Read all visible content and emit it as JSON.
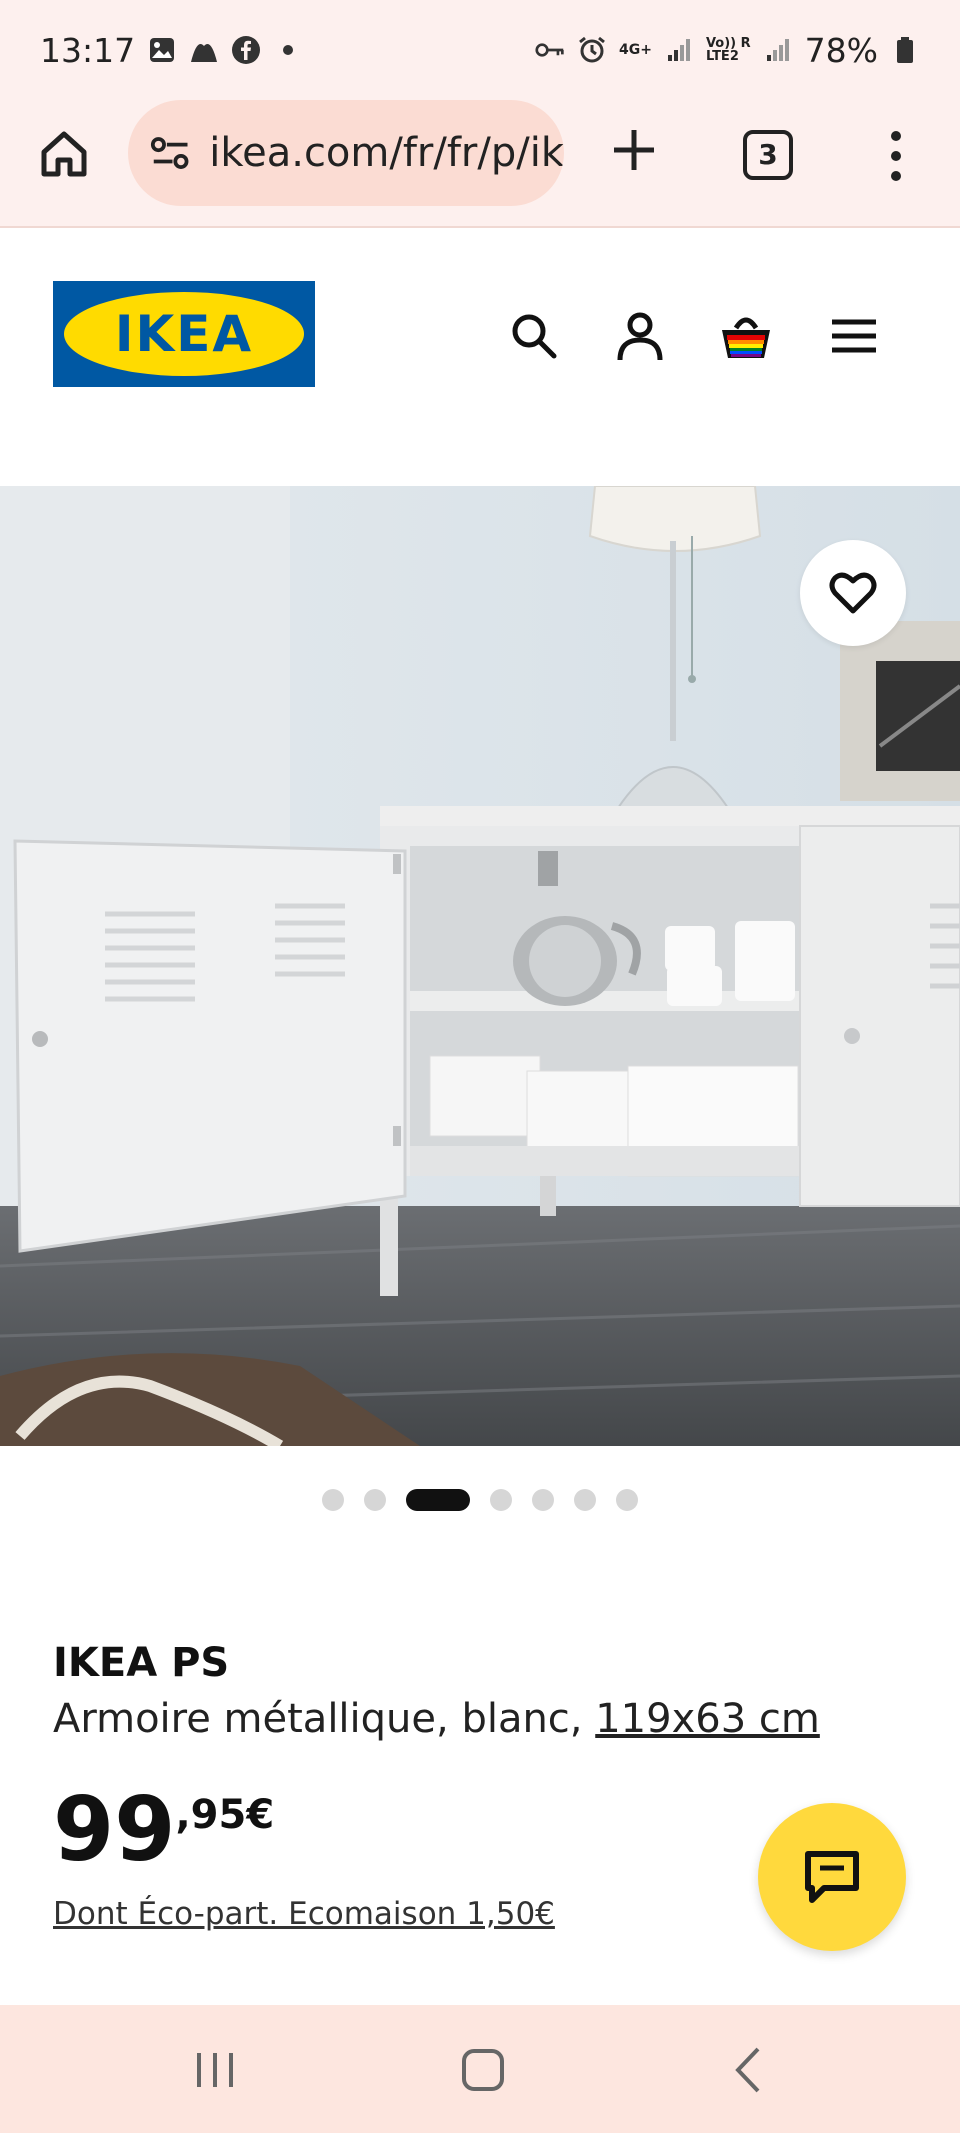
{
  "status": {
    "time": "13:17",
    "battery": "78%",
    "left_icons": [
      "gallery-icon",
      "mountain-icon",
      "facebook-icon",
      "dot-icon"
    ],
    "right_icons": [
      "vpn-key-icon",
      "alarm-icon",
      "4g-plus-icon",
      "signal-icon",
      "volte-lte2-icon",
      "signal-r-icon",
      "battery-icon"
    ],
    "network": "4G+",
    "lte": "Vo)) R\nLTE2"
  },
  "browser": {
    "url": "ikea.com/fr/fr/p/ik",
    "tabs_count": "3",
    "home_icon": "home-icon",
    "plus_label": "+"
  },
  "header": {
    "logo_text": "IKEA",
    "icons": [
      "search-icon",
      "account-icon",
      "basket-icon",
      "hamburger-menu-icon"
    ]
  },
  "gallery": {
    "dots": 7,
    "active_index": 2
  },
  "product": {
    "name": "IKEA PS",
    "description": "Armoire métallique, blanc, ",
    "size_link": "119x63 cm",
    "price_int": "99",
    "price_dec": ",95€",
    "ecopart": "Dont Éco-part. Ecomaison 1,50€"
  },
  "colors": {
    "ikea_blue": "#0058a3",
    "ikea_yellow": "#ffdb00",
    "chat_yellow": "#ffd93d",
    "browser_bg": "#fdf0ee"
  }
}
